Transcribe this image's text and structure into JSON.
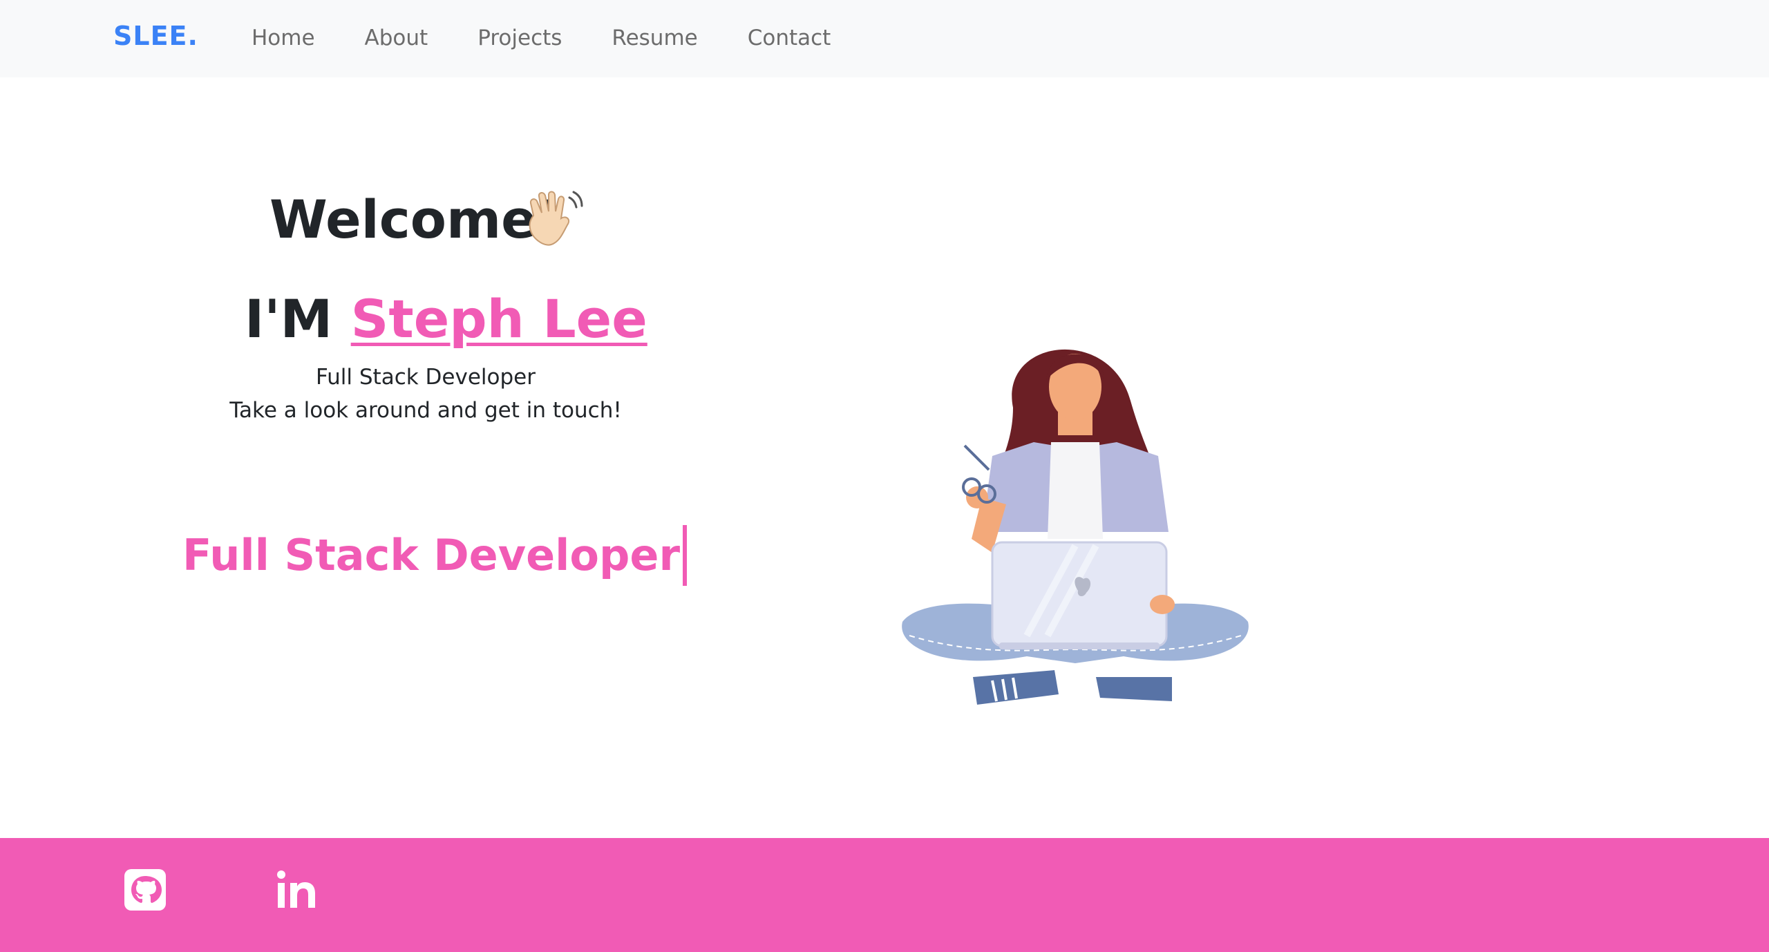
{
  "navbar": {
    "brand": "SLEE.",
    "links": [
      "Home",
      "About",
      "Projects",
      "Resume",
      "Contact"
    ]
  },
  "hero": {
    "welcome": "Welcome!",
    "intro_prefix": "I'M",
    "name": "Steph Lee",
    "tagline_1": "Full Stack Developer",
    "tagline_2": "Take a look around and get in touch!",
    "typewriter": "Full Stack Developer"
  },
  "icons": {
    "wave": "waving-hand-icon",
    "github": "github-icon",
    "linkedin": "linkedin-icon"
  },
  "colors": {
    "brand": "#3b82f6",
    "accent": "#f15bb5",
    "navbar_bg": "#f8f9fa",
    "text": "#212529"
  }
}
